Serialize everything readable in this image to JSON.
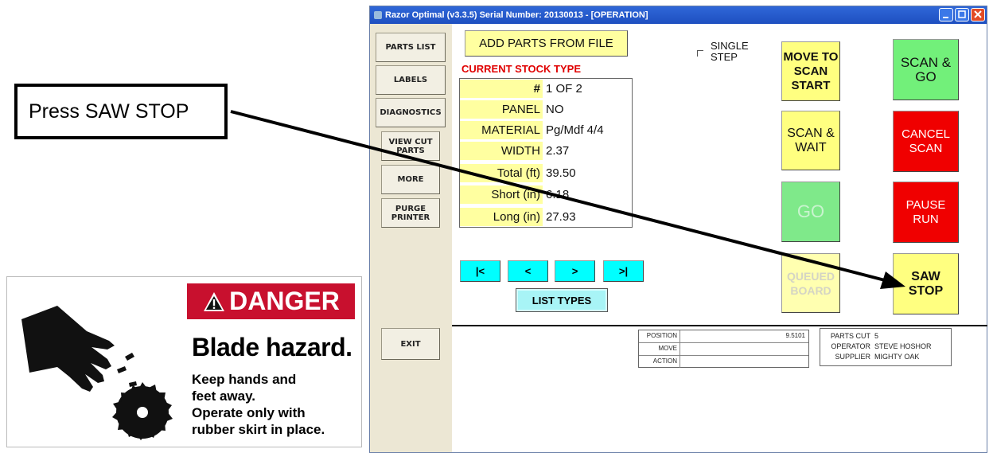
{
  "callout": {
    "text": "Press SAW STOP"
  },
  "danger_sign": {
    "banner": "DANGER",
    "headline": "Blade hazard.",
    "lines": [
      "Keep hands and",
      "feet away.",
      "Operate only with",
      "rubber skirt in place."
    ],
    "colors": {
      "banner": "#c8102e"
    },
    "icons": [
      "warning-triangle-icon",
      "hand-icon",
      "saw-blade-icon"
    ]
  },
  "window": {
    "title": "Razor Optimal (v3.3.5)  Serial Number: 20130013 - [OPERATION]"
  },
  "sidebar": {
    "items": [
      "PARTS LIST",
      "LABELS",
      "DIAGNOSTICS",
      "VIEW CUT PARTS",
      "MORE",
      "PURGE PRINTER",
      "EXIT"
    ]
  },
  "main": {
    "add_parts_label": "ADD PARTS FROM FILE",
    "current_stock_title": "CURRENT STOCK TYPE",
    "stock_rows": [
      {
        "key": "#",
        "value": "1 OF 2"
      },
      {
        "key": "PANEL",
        "value": "NO"
      },
      {
        "key": "MATERIAL",
        "value": "Pg/Mdf 4/4"
      },
      {
        "key": "WIDTH",
        "value": "2.37"
      },
      {
        "key": "Total (ft)",
        "value": "39.50"
      },
      {
        "key": "Short (in)",
        "value": "6.18"
      },
      {
        "key": "Long (in)",
        "value": "27.93"
      }
    ],
    "single_step": {
      "line1": "SINGLE",
      "line2": "STEP",
      "checked": false
    },
    "buttons": {
      "move_to_scan_start": [
        "MOVE TO",
        "SCAN",
        "START"
      ],
      "scan_and_go": [
        "SCAN &",
        "GO"
      ],
      "scan_and_wait": [
        "SCAN &",
        "WAIT"
      ],
      "cancel_scan": [
        "CANCEL",
        "SCAN"
      ],
      "go": [
        "GO"
      ],
      "pause_run": [
        "PAUSE",
        "RUN"
      ],
      "queued_board": [
        "QUEUED",
        "BOARD"
      ],
      "saw_stop": [
        "SAW",
        "STOP"
      ]
    },
    "nav": {
      "first": "|<",
      "prev": "<",
      "next": ">",
      "last": ">|"
    },
    "list_types_label": "LIST TYPES",
    "status_table": [
      {
        "label": "POSITION",
        "value": "9.5101"
      },
      {
        "label": "MOVE",
        "value": ""
      },
      {
        "label": "ACTION",
        "value": ""
      }
    ],
    "parts_info": [
      {
        "label": "PARTS CUT",
        "value": "5"
      },
      {
        "label": "OPERATOR",
        "value": "STEVE HOSHOR"
      },
      {
        "label": "SUPPLIER",
        "value": "MIGHTY OAK"
      }
    ]
  },
  "colors": {
    "yellow_button": "#ffff80",
    "green_button": "#72f07a",
    "red_button": "#f00000",
    "cyan_nav": "#00ffff",
    "stock_title": "#e00000"
  }
}
